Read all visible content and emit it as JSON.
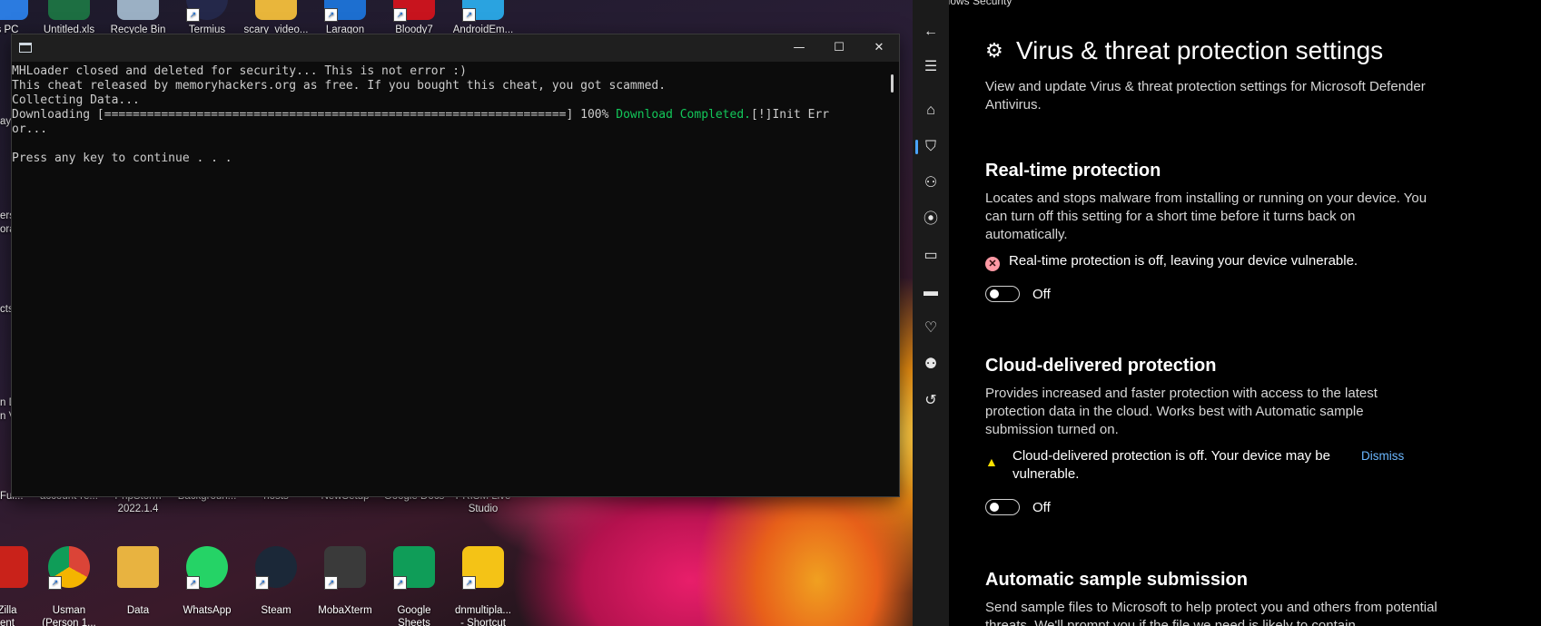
{
  "desktop": {
    "top_icons": [
      {
        "label": "s PC",
        "color": "#2b7be0"
      },
      {
        "label": "Untitled.xls",
        "color": "#1d6f42"
      },
      {
        "label": "Recycle Bin",
        "color": "#9bb0c4"
      },
      {
        "label": "Termius",
        "color": "#24284a"
      },
      {
        "label": "scary_video...",
        "color": "#e9b63b"
      },
      {
        "label": "Laragon",
        "color": "#1d6fd0"
      },
      {
        "label": "Bloody7",
        "color": "#c8141e"
      },
      {
        "label": "AndroidEm...",
        "color": "#2aa3e0"
      }
    ],
    "mid_labels": [
      "ntFul...",
      "account-re...",
      "PhpStorm\n2022.1.4",
      "Backgroun...",
      "hosts",
      "NewSetup",
      "Google Docs",
      "PRISM Live\nStudio"
    ],
    "left_cut_labels": [
      "ay",
      "ers",
      "ora",
      "cts",
      "n D",
      "n V"
    ],
    "bottom_icons": [
      {
        "label": "Zilla\nent",
        "color": "#c9221a"
      },
      {
        "label": "Usman\n(Person 1...",
        "color": "#ffffff"
      },
      {
        "label": "Data",
        "color": "#e8b340"
      },
      {
        "label": "WhatsApp",
        "color": "#25d366"
      },
      {
        "label": "Steam",
        "color": "#1b2838"
      },
      {
        "label": "MobaXterm",
        "color": "#3a3a3a"
      },
      {
        "label": "Google\nSheets",
        "color": "#0f9d58"
      },
      {
        "label": "dnmultipla...\n- Shortcut",
        "color": "#f4c316"
      }
    ]
  },
  "console": {
    "lines_before": "MHLoader closed and deleted for security... This is not error :)\nThis cheat released by memoryhackers.org as free. If you bought this cheat, you got scammed.\nCollecting Data...\nDownloading [=================================================================] 100% ",
    "download_status": "Download Completed.",
    "lines_after": "[!]Init Err\nor...\n\nPress any key to continue . . ."
  },
  "security": {
    "window_title": "Windows Security",
    "page_title": "Virus & threat protection settings",
    "page_desc": "View and update Virus & threat protection settings for Microsoft Defender Antivirus.",
    "sections": [
      {
        "title": "Real-time protection",
        "desc": "Locates and stops malware from installing or running on your device. You can turn off this setting for a short time before it turns back on automatically.",
        "status": "Real-time protection is off, leaving your device vulnerable.",
        "toggle": "Off"
      },
      {
        "title": "Cloud-delivered protection",
        "desc": "Provides increased and faster protection with access to the latest protection data in the cloud. Works best with Automatic sample submission turned on.",
        "status": "Cloud-delivered protection is off. Your device may be vulnerable.",
        "dismiss": "Dismiss",
        "toggle": "Off"
      },
      {
        "title": "Automatic sample submission",
        "desc": "Send sample files to Microsoft to help protect you and others from potential threats. We'll prompt you if the file we need is likely to contain"
      }
    ],
    "nav_icons": [
      "back-arrow-icon",
      "hamburger-icon",
      "home-icon",
      "shield-icon",
      "account-icon",
      "firewall-icon",
      "app-browser-icon",
      "device-security-icon",
      "health-icon",
      "family-icon",
      "history-icon"
    ]
  }
}
